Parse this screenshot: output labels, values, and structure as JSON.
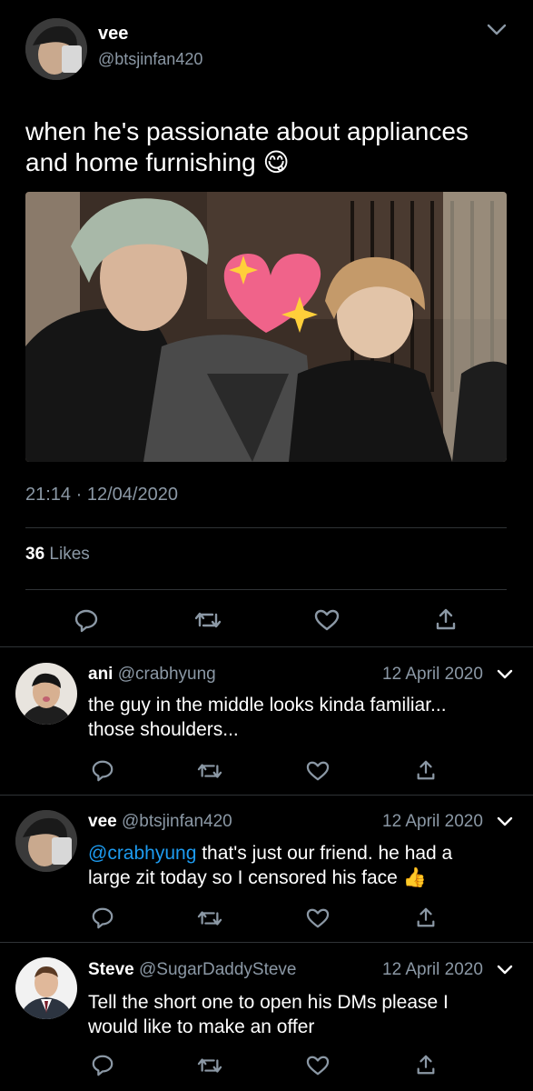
{
  "main_tweet": {
    "display_name": "vee",
    "handle": "@btsjinfan420",
    "text": "when he's passionate about appliances and home furnishing",
    "emoji": "😋",
    "time": "21:14",
    "separator": "·",
    "date": "12/04/2020",
    "likes_count": "36",
    "likes_label": "Likes"
  },
  "replies": [
    {
      "display_name": "ani",
      "handle": "@crabhyung",
      "date": "12 April 2020",
      "text": "the guy in the middle looks kinda familiar... those shoulders..."
    },
    {
      "display_name": "vee",
      "handle": "@btsjinfan420",
      "date": "12 April 2020",
      "mention": "@crabhyung",
      "text": " that's just our friend. he had a large zit today so I censored his face",
      "emoji": "👍"
    },
    {
      "display_name": "Steve",
      "handle": "@SugarDaddySteve",
      "date": "12 April 2020",
      "text": "Tell the short one to open his DMs please I would like to make an offer"
    }
  ],
  "colors": {
    "background": "#000000",
    "text": "#ffffff",
    "muted": "#8b98a5",
    "link": "#1d9bf0",
    "divider": "#2f3336"
  },
  "icons": {
    "reply": "reply-icon",
    "retweet": "retweet-icon",
    "like": "heart-icon",
    "share": "share-icon",
    "more": "chevron-down-icon"
  }
}
